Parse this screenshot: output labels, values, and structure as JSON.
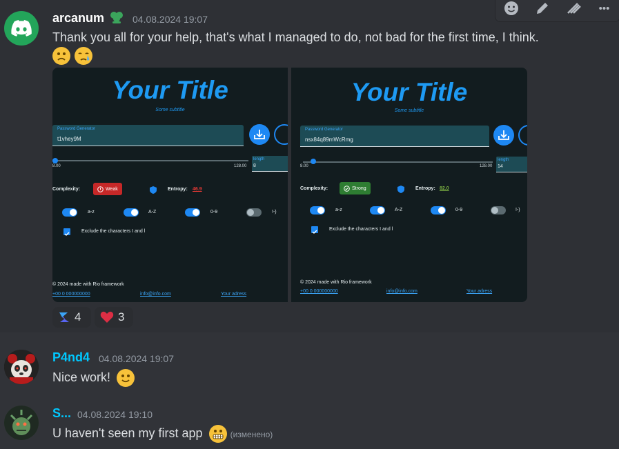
{
  "toolbar": {
    "icons": [
      "add-reaction-icon",
      "edit-icon",
      "forward-icon",
      "more-icon"
    ],
    "more_label": "•••"
  },
  "messages": [
    {
      "username": "arcanum",
      "username_color": "#ffffff",
      "timestamp": "04.08.2024 19:07",
      "text": "Thank you all for your help, that's what I managed to do, not bad for the first time, I think.",
      "app_screenshots": [
        {
          "title": "Your Title",
          "subtitle": "Some subtitle",
          "pw_label": "Password Generator",
          "password": "t1vhey9M",
          "slider_min": "8.00",
          "slider_max": "128.00",
          "length_label": "length",
          "length_value": "8",
          "complexity_label": "Complexity:",
          "complexity_value": "Weak",
          "entropy_label": "Entropy:",
          "entropy_value": "46.9",
          "entropy_color": "#e53935",
          "toggles": [
            {
              "label": "a-z",
              "on": true
            },
            {
              "label": "A-Z",
              "on": true
            },
            {
              "label": "0-9",
              "on": true
            },
            {
              "label": "!-)",
              "on": false
            }
          ],
          "exclude_label": "Exclude the characters I and l",
          "footer": "© 2024 made with Rio framework",
          "links": [
            "+00 0 000000000",
            "info@info.com",
            "Your adress"
          ]
        },
        {
          "title": "Your Title",
          "subtitle": "Some subtitle",
          "pw_label": "Password Generator",
          "password": "nsx84q89mWcRmg",
          "slider_min": "8.00",
          "slider_max": "128.00",
          "length_label": "length",
          "length_value": "14",
          "complexity_label": "Complexity:",
          "complexity_value": "Strong",
          "entropy_label": "Entropy:",
          "entropy_value": "82.0",
          "entropy_color": "#7cb342",
          "toggles": [
            {
              "label": "a-z",
              "on": true
            },
            {
              "label": "A-Z",
              "on": true
            },
            {
              "label": "0-9",
              "on": true
            },
            {
              "label": "!-)",
              "on": false
            }
          ],
          "exclude_label": "Exclude the characters I and l",
          "footer": "© 2024 made with Rio framework",
          "links": [
            "+00 0 000000000",
            "info@info.com",
            "Your adress"
          ]
        }
      ],
      "reactions": [
        {
          "icon": "rio-logo-icon",
          "count": "4"
        },
        {
          "icon": "heart-icon",
          "count": "3"
        }
      ]
    },
    {
      "username": "P4nd4",
      "username_color": "#00c8ff",
      "timestamp": "04.08.2024 19:07",
      "text": "Nice work!"
    },
    {
      "username": "S...",
      "username_color": "#00c8ff",
      "timestamp": "04.08.2024 19:10",
      "text": "U haven't seen my first app",
      "edited": "(изменено)"
    }
  ],
  "colors": {
    "accent": "#1e9af3",
    "weak": "#c62828",
    "strong": "#2e7d32",
    "discord_blurple": "#5865f2"
  }
}
